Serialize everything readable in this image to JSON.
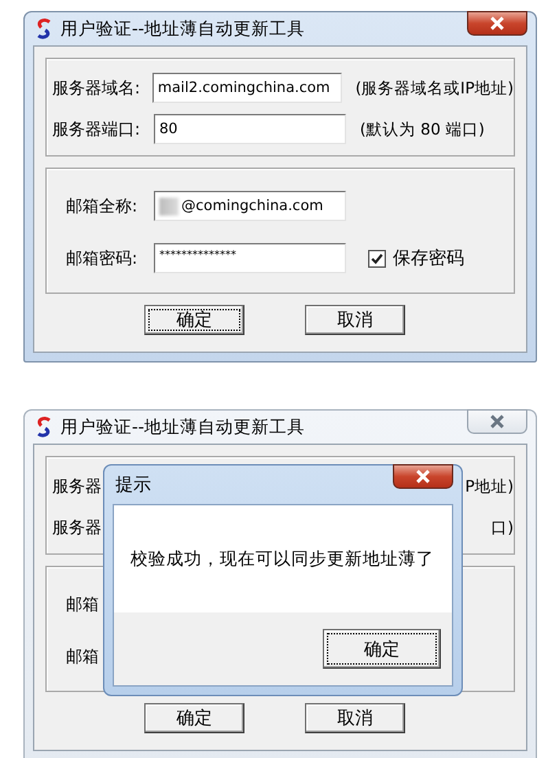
{
  "main_window": {
    "title": "用户验证--地址薄自动更新工具",
    "active": true,
    "server_group": [
      {
        "label": "服务器域名:",
        "value": "mail2.comingchina.com",
        "note": "(服务器域名或IP地址)"
      },
      {
        "label": "服务器端口:",
        "value": "80",
        "note": "(默认为 80 端口)"
      }
    ],
    "mail_group": [
      {
        "label": "邮箱全称:",
        "value": "@comingchina.com",
        "blurred_prefix": true
      },
      {
        "label": "邮箱密码:",
        "value": "**************",
        "checkbox": {
          "label": "保存密码",
          "checked": true
        }
      }
    ],
    "buttons": [
      {
        "label": "确定",
        "focused": true
      },
      {
        "label": "取消",
        "focused": false
      }
    ]
  },
  "second_window": {
    "title": "用户验证--地址薄自动更新工具",
    "active": false,
    "server_group": [
      {
        "label": "服务器",
        "note": "P地址)"
      },
      {
        "label": "服务器",
        "note": "口)"
      }
    ],
    "mail_group": [
      {
        "label": "邮箱"
      },
      {
        "label": "邮箱"
      }
    ],
    "buttons": [
      {
        "label": "确定",
        "focused": false
      },
      {
        "label": "取消",
        "focused": false
      }
    ],
    "dialog": {
      "title": "提示",
      "active": true,
      "message": "校验成功，现在可以同步更新地址薄了",
      "button": {
        "label": "确定",
        "focused": true
      }
    }
  }
}
